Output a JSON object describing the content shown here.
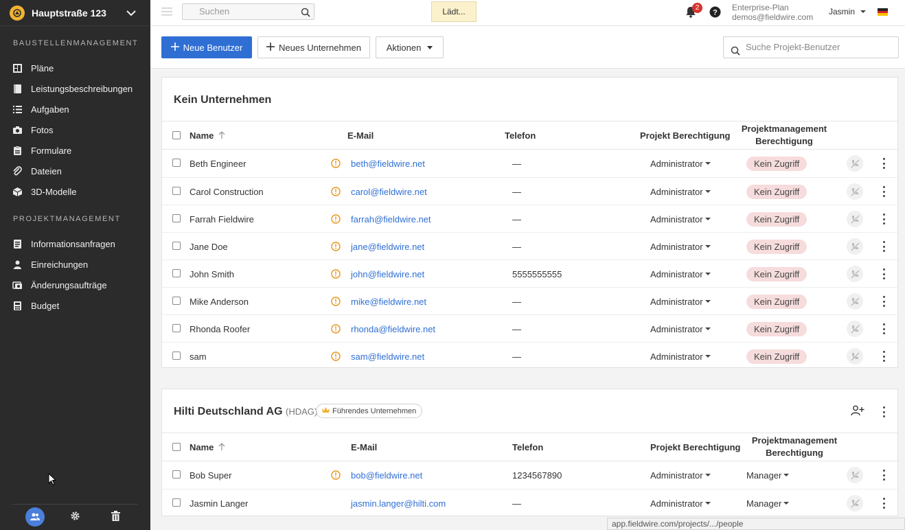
{
  "sidebar": {
    "project_name": "Hauptstraße 123",
    "section1_title": "BAUSTELLENMANAGEMENT",
    "section1_items": [
      {
        "label": "Pläne",
        "icon": "plans-icon"
      },
      {
        "label": "Leistungsbeschreibungen",
        "icon": "specifications-icon"
      },
      {
        "label": "Aufgaben",
        "icon": "tasks-icon"
      },
      {
        "label": "Fotos",
        "icon": "camera-icon"
      },
      {
        "label": "Formulare",
        "icon": "forms-icon"
      },
      {
        "label": "Dateien",
        "icon": "paperclip-icon"
      },
      {
        "label": "3D-Modelle",
        "icon": "cube-icon"
      }
    ],
    "section2_title": "PROJEKTMANAGEMENT",
    "section2_items": [
      {
        "label": "Informationsanfragen",
        "icon": "rfi-icon"
      },
      {
        "label": "Einreichungen",
        "icon": "submittals-icon"
      },
      {
        "label": "Änderungsaufträge",
        "icon": "change-orders-icon"
      },
      {
        "label": "Budget",
        "icon": "calculator-icon"
      }
    ]
  },
  "topbar": {
    "search_placeholder": "Suchen",
    "loading_text": "Lädt...",
    "notification_count": "2",
    "plan_name": "Enterprise-Plan",
    "plan_email": "demos@fieldwire.com",
    "user_name": "Jasmin"
  },
  "toolbar": {
    "new_user": "Neue Benutzer",
    "new_company": "Neues Unternehmen",
    "actions": "Aktionen",
    "search_placeholder": "Suche Projekt-Benutzer"
  },
  "group1": {
    "title": "Kein Unternehmen",
    "headers": {
      "name": "Name",
      "email": "E-Mail",
      "phone": "Telefon",
      "permission": "Projekt Berechtigung",
      "pm_permission_line1": "Projektmanagement",
      "pm_permission_line2": "Berechtigung"
    },
    "rows": [
      {
        "name": "Beth Engineer",
        "email": "beth@fieldwire.net",
        "phone": "—",
        "permission": "Administrator",
        "pm": "Kein Zugriff"
      },
      {
        "name": "Carol Construction",
        "email": "carol@fieldwire.net",
        "phone": "—",
        "permission": "Administrator",
        "pm": "Kein Zugriff"
      },
      {
        "name": "Farrah Fieldwire",
        "email": "farrah@fieldwire.net",
        "phone": "—",
        "permission": "Administrator",
        "pm": "Kein Zugriff"
      },
      {
        "name": "Jane Doe",
        "email": "jane@fieldwire.net",
        "phone": "—",
        "permission": "Administrator",
        "pm": "Kein Zugriff"
      },
      {
        "name": "John Smith",
        "email": "john@fieldwire.net",
        "phone": "5555555555",
        "permission": "Administrator",
        "pm": "Kein Zugriff"
      },
      {
        "name": "Mike Anderson",
        "email": "mike@fieldwire.net",
        "phone": "—",
        "permission": "Administrator",
        "pm": "Kein Zugriff"
      },
      {
        "name": "Rhonda Roofer",
        "email": "rhonda@fieldwire.net",
        "phone": "—",
        "permission": "Administrator",
        "pm": "Kein Zugriff"
      },
      {
        "name": "sam",
        "email": "sam@fieldwire.net",
        "phone": "—",
        "permission": "Administrator",
        "pm": "Kein Zugriff"
      }
    ]
  },
  "group2": {
    "title": "Hilti Deutschland AG",
    "abbr": "(HDAG)",
    "badge": "Führendes Unternehmen",
    "headers": {
      "name": "Name",
      "email": "E-Mail",
      "phone": "Telefon",
      "permission": "Projekt Berechtigung",
      "pm_permission_line1": "Projektmanagement",
      "pm_permission_line2": "Berechtigung"
    },
    "rows": [
      {
        "name": "Bob Super",
        "email": "bob@fieldwire.net",
        "phone": "1234567890",
        "permission": "Administrator",
        "pm": "Manager",
        "warn": true
      },
      {
        "name": "Jasmin Langer",
        "email": "jasmin.langer@hilti.com",
        "phone": "—",
        "permission": "Administrator",
        "pm": "Manager",
        "warn": false
      }
    ]
  },
  "statusbar": "app.fieldwire.com/projects/.../people",
  "colors": {
    "accent": "#2f6fd4",
    "sidebar": "#2b2b2b",
    "warning": "#e8941a",
    "no_access": "#f6dcdc",
    "badge": "#d9332f"
  }
}
